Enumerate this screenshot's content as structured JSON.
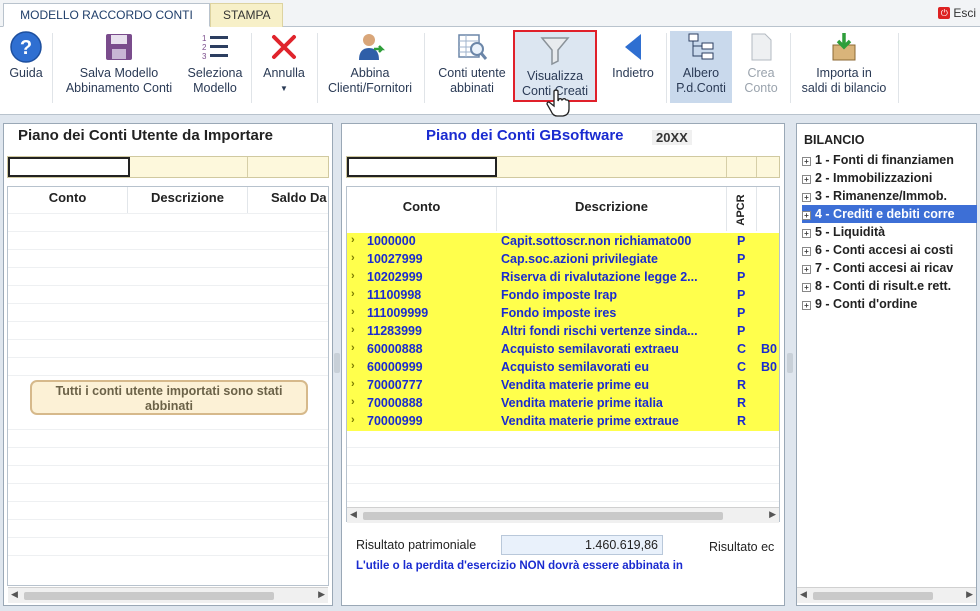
{
  "tabs": {
    "active": "MODELLO RACCORDO CONTI",
    "other": "STAMPA",
    "exit": "Esci"
  },
  "toolbar": {
    "guida": "Guida",
    "salva1": "Salva Modello",
    "salva2": "Abbinamento Conti",
    "seleziona1": "Seleziona",
    "seleziona2": "Modello",
    "annulla": "Annulla",
    "abbina1": "Abbina",
    "abbina2": "Clienti/Fornitori",
    "conti1": "Conti utente",
    "conti2": "abbinati",
    "visualizza1": "Visualizza",
    "visualizza2": "Conti Creati",
    "indietro": "Indietro",
    "albero1": "Albero",
    "albero2": "P.d.Conti",
    "crea1": "Crea",
    "crea2": "Conto",
    "importa1": "Importa in",
    "importa2": "saldi di bilancio"
  },
  "left": {
    "title": "Piano dei Conti Utente da Importare",
    "cols": [
      "Conto",
      "Descrizione",
      "Saldo Da"
    ],
    "notice1": "Tutti i conti utente importati sono stati",
    "notice2": "abbinati"
  },
  "middle": {
    "title": "Piano dei Conti GBsoftware",
    "year": "20XX",
    "cols": [
      "Conto",
      "Descrizione",
      "APCR"
    ],
    "rows": [
      {
        "conto": "1000000",
        "desc": "Capit.sottoscr.non richiamato00",
        "apcr": "P",
        "extra": ""
      },
      {
        "conto": "10027999",
        "desc": "Cap.soc.azioni privilegiate",
        "apcr": "P",
        "extra": ""
      },
      {
        "conto": "10202999",
        "desc": "Riserva di rivalutazione legge 2...",
        "apcr": "P",
        "extra": ""
      },
      {
        "conto": "11100998",
        "desc": "Fondo imposte Irap",
        "apcr": "P",
        "extra": ""
      },
      {
        "conto": "111009999",
        "desc": "Fondo imposte ires",
        "apcr": "P",
        "extra": ""
      },
      {
        "conto": "11283999",
        "desc": "Altri fondi rischi vertenze sinda...",
        "apcr": "P",
        "extra": ""
      },
      {
        "conto": "60000888",
        "desc": "Acquisto semilavorati extraeu",
        "apcr": "C",
        "extra": "B0"
      },
      {
        "conto": "60000999",
        "desc": "Acquisto semilavorati eu",
        "apcr": "C",
        "extra": "B0"
      },
      {
        "conto": "70000777",
        "desc": "Vendita materie prime eu",
        "apcr": "R",
        "extra": ""
      },
      {
        "conto": "70000888",
        "desc": "Vendita materie prime italia",
        "apcr": "R",
        "extra": ""
      },
      {
        "conto": "70000999",
        "desc": "Vendita materie prime extraue",
        "apcr": "R",
        "extra": ""
      }
    ],
    "result_label": "Risultato patrimoniale",
    "result_value": "1.460.619,86",
    "result2_label": "Risultato ec",
    "note": "L'utile o la perdita d'esercizio NON dovrà essere abbinata in"
  },
  "right": {
    "title": "BILANCIO",
    "nodes": [
      "1 - Fonti di finanziamen",
      "2 - Immobilizzazioni",
      "3 - Rimanenze/Immob.",
      "4 - Crediti e debiti corre",
      "5 - Liquidità",
      "6 - Conti accesi ai costi",
      "7 - Conti accesi ai ricav",
      "8 - Conti di risult.e rett.",
      "9 - Conti d'ordine"
    ]
  },
  "colors": {
    "accent": "#1a2bd0",
    "row_yellow": "#ffff4c",
    "selected": "#3d6fd6",
    "highlight_box": "#e0202a"
  }
}
